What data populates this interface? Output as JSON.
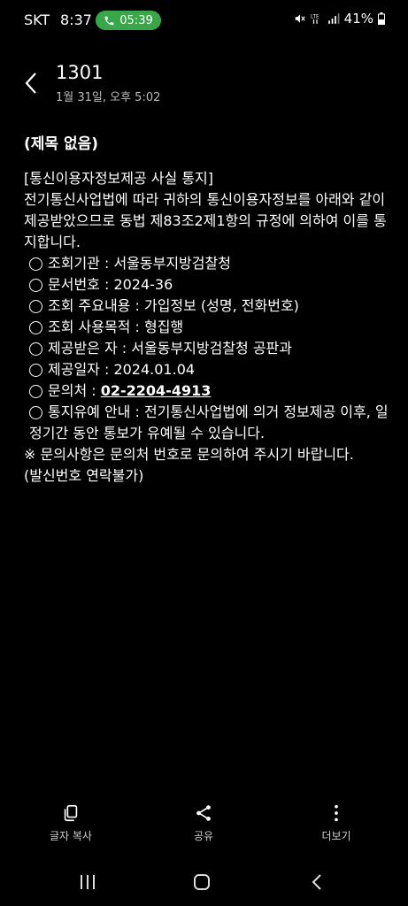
{
  "status_bar": {
    "carrier": "SKT",
    "time": "8:37",
    "call_timer": "05:39",
    "battery": "41%"
  },
  "header": {
    "title": "1301",
    "date": "1월 31일, 오후 5:02"
  },
  "message": {
    "subject": "(제목 없음)",
    "intro": [
      "[통신이용자정보제공 사실 통지]",
      "전기통신사업법에 따라 귀하의 통신이용자정보를 아래와 같이 제공받았으므로 동법 제83조2제1항의 규정에 의하여 이를 통지합니다."
    ],
    "items": [
      "조회기관 : 서울동부지방검찰청",
      "문서번호 : 2024-36",
      "조회 주요내용 : 가입정보 (성명, 전화번호)",
      "조회 사용목적 : 형집행",
      "제공받은 자 : 서울동부지방검찰청 공판과",
      "제공일자 : 2024.01.04"
    ],
    "contact_label": "문의처 : ",
    "contact_number": "02-2204-4913",
    "notice_item": "통지유예 안내 : 전기통신사업법에 의거 정보제공 이후, 일정기간 동안 통보가 유예될 수 있습니다.",
    "footer": [
      "※ 문의사항은 문의처 번호로 문의하여 주시기 바랍니다.",
      "(발신번호 연락불가)"
    ]
  },
  "actions": {
    "copy": "글자 복사",
    "share": "공유",
    "more": "더보기"
  },
  "colors": {
    "background": "#000000",
    "call_pill": "#3aa64a"
  }
}
